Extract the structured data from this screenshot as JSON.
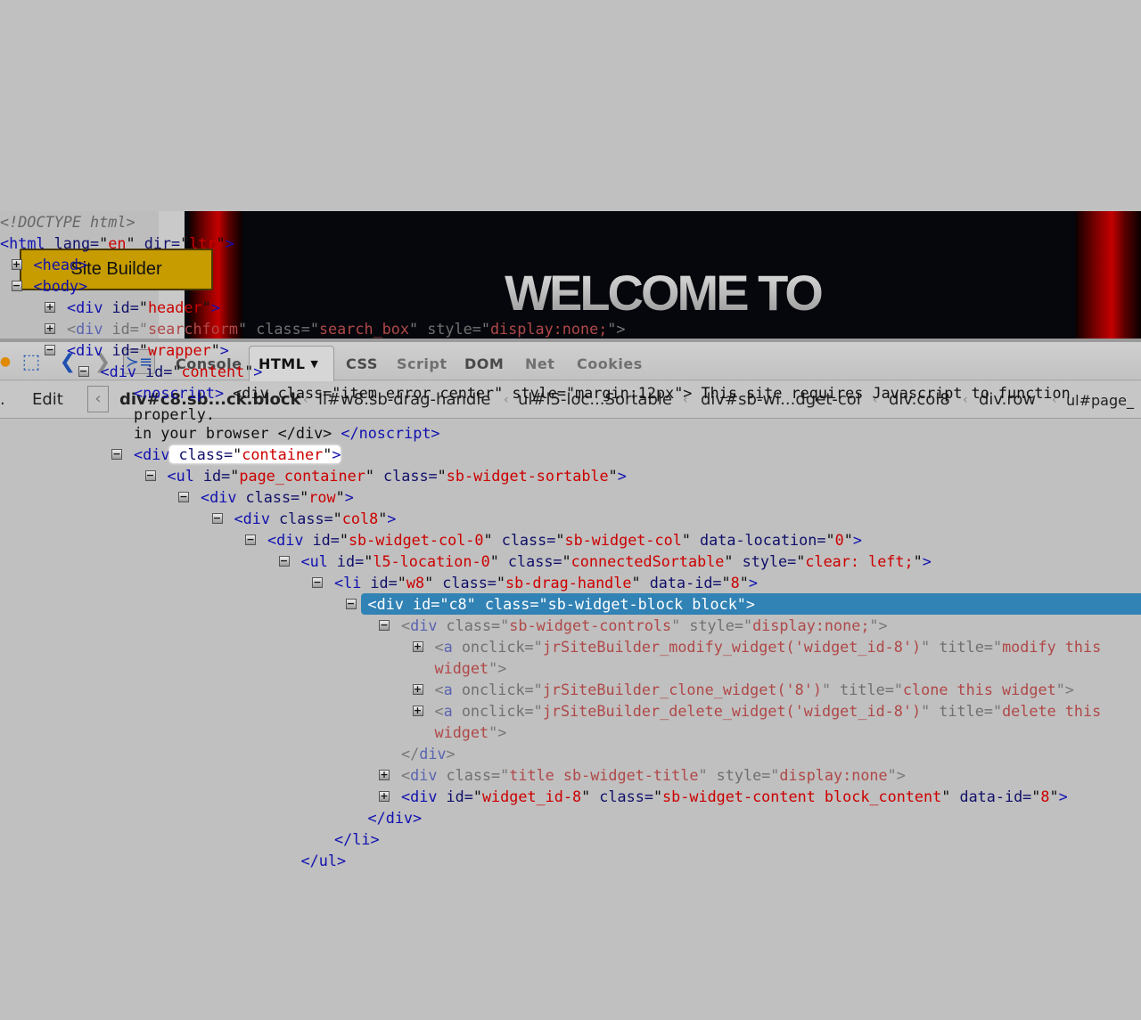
{
  "site": {
    "button": "Site Builder",
    "banner_text": "WELCOME TO"
  },
  "toolbar": {
    "tabs": [
      "Console",
      "HTML",
      "CSS",
      "Script",
      "DOM",
      "Net",
      "Cookies"
    ],
    "active_tab": "HTML"
  },
  "breadcrumbs": {
    "edit": "Edit",
    "items": [
      "div#c8.sb...ck.block",
      "li#w8.sb-drag-handle",
      "ul#l5-loc...Sortable",
      "div#sb-wi...dget-col",
      "div.col8",
      "div.row",
      "ul#page_"
    ]
  },
  "code": [
    {
      "lvl": 0,
      "t": "",
      "p": [
        [
          "cm",
          "<!DOCTYPE html>"
        ]
      ]
    },
    {
      "lvl": 0,
      "t": "",
      "p": [
        [
          "br",
          "<"
        ],
        [
          "tg",
          "html"
        ],
        [
          "an",
          " lang="
        ],
        [
          "tx",
          "\""
        ],
        [
          "av",
          "en"
        ],
        [
          "tx",
          "\""
        ],
        [
          "an",
          " dir="
        ],
        [
          "tx",
          "\""
        ],
        [
          "av",
          "ltr"
        ],
        [
          "tx",
          "\""
        ],
        [
          "br",
          ">"
        ]
      ]
    },
    {
      "lvl": 1,
      "t": "+",
      "p": [
        [
          "br",
          "<"
        ],
        [
          "tg",
          "head"
        ],
        [
          "br",
          ">"
        ]
      ]
    },
    {
      "lvl": 1,
      "t": "-",
      "p": [
        [
          "br",
          "<"
        ],
        [
          "tg",
          "body"
        ],
        [
          "br",
          ">"
        ]
      ]
    },
    {
      "lvl": 2,
      "t": "+",
      "p": [
        [
          "br",
          "<"
        ],
        [
          "tg",
          "div"
        ],
        [
          "an",
          " id="
        ],
        [
          "tx",
          "\""
        ],
        [
          "av",
          "header"
        ],
        [
          "tx",
          "\""
        ],
        [
          "br",
          ">"
        ]
      ]
    },
    {
      "lvl": 2,
      "t": "+",
      "f": 1,
      "p": [
        [
          "br",
          "<"
        ],
        [
          "tg",
          "div"
        ],
        [
          "an",
          " id="
        ],
        [
          "br",
          "\""
        ],
        [
          "av",
          "searchform"
        ],
        [
          "br",
          "\""
        ],
        [
          "an",
          " class="
        ],
        [
          "br",
          "\""
        ],
        [
          "av",
          "search_box"
        ],
        [
          "br",
          "\""
        ],
        [
          "an",
          " style="
        ],
        [
          "br",
          "\""
        ],
        [
          "av",
          "display:none;"
        ],
        [
          "br",
          "\">"
        ]
      ]
    },
    {
      "lvl": 2,
      "t": "-",
      "p": [
        [
          "br",
          "<"
        ],
        [
          "tg",
          "div"
        ],
        [
          "an",
          " id="
        ],
        [
          "tx",
          "\""
        ],
        [
          "av",
          "wrapper"
        ],
        [
          "tx",
          "\""
        ],
        [
          "br",
          ">"
        ]
      ]
    },
    {
      "lvl": 3,
      "t": "-",
      "p": [
        [
          "br",
          "<"
        ],
        [
          "tg",
          "div"
        ],
        [
          "an",
          " id="
        ],
        [
          "tx",
          "\""
        ],
        [
          "av",
          "content"
        ],
        [
          "tx",
          "\""
        ],
        [
          "br",
          ">"
        ]
      ]
    },
    {
      "lvl": 4,
      "t": "",
      "p": [
        [
          "br",
          "<"
        ],
        [
          "tg",
          "noscript"
        ],
        [
          "br",
          ">"
        ],
        [
          "tx",
          " <div class=\"item error center\" style=\"margin:12px\"> This site requires Javascript to function properly."
        ]
      ]
    },
    {
      "lvl": 4,
      "t": "",
      "w": 1,
      "p": [
        [
          "tx",
          "in your browser </div> "
        ],
        [
          "br",
          "</"
        ],
        [
          "tg",
          "noscript"
        ],
        [
          "br",
          ">"
        ]
      ]
    },
    {
      "lvl": 4,
      "t": "-",
      "h": 1,
      "p": [
        [
          "br",
          "<"
        ],
        [
          "tg",
          "div"
        ],
        [
          "an",
          " class="
        ],
        [
          "tx",
          "\""
        ],
        [
          "av",
          "container"
        ],
        [
          "tx",
          "\""
        ],
        [
          "br",
          ">"
        ]
      ]
    },
    {
      "lvl": 5,
      "t": "-",
      "p": [
        [
          "br",
          "<"
        ],
        [
          "tg",
          "ul"
        ],
        [
          "an",
          " id="
        ],
        [
          "tx",
          "\""
        ],
        [
          "av",
          "page_container"
        ],
        [
          "tx",
          "\""
        ],
        [
          "an",
          " class="
        ],
        [
          "tx",
          "\""
        ],
        [
          "av",
          "sb-widget-sortable"
        ],
        [
          "tx",
          "\""
        ],
        [
          "br",
          ">"
        ]
      ]
    },
    {
      "lvl": 6,
      "t": "-",
      "p": [
        [
          "br",
          "<"
        ],
        [
          "tg",
          "div"
        ],
        [
          "an",
          " class="
        ],
        [
          "tx",
          "\""
        ],
        [
          "av",
          "row"
        ],
        [
          "tx",
          "\""
        ],
        [
          "br",
          ">"
        ]
      ]
    },
    {
      "lvl": 7,
      "t": "-",
      "p": [
        [
          "br",
          "<"
        ],
        [
          "tg",
          "div"
        ],
        [
          "an",
          " class="
        ],
        [
          "tx",
          "\""
        ],
        [
          "av",
          "col8"
        ],
        [
          "tx",
          "\""
        ],
        [
          "br",
          ">"
        ]
      ]
    },
    {
      "lvl": 8,
      "t": "-",
      "p": [
        [
          "br",
          "<"
        ],
        [
          "tg",
          "div"
        ],
        [
          "an",
          " id="
        ],
        [
          "tx",
          "\""
        ],
        [
          "av",
          "sb-widget-col-0"
        ],
        [
          "tx",
          "\""
        ],
        [
          "an",
          " class="
        ],
        [
          "tx",
          "\""
        ],
        [
          "av",
          "sb-widget-col"
        ],
        [
          "tx",
          "\""
        ],
        [
          "an",
          " data-location="
        ],
        [
          "tx",
          "\""
        ],
        [
          "av",
          "0"
        ],
        [
          "tx",
          "\""
        ],
        [
          "br",
          ">"
        ]
      ]
    },
    {
      "lvl": 9,
      "t": "-",
      "p": [
        [
          "br",
          "<"
        ],
        [
          "tg",
          "ul"
        ],
        [
          "an",
          " id="
        ],
        [
          "tx",
          "\""
        ],
        [
          "av",
          "l5-location-0"
        ],
        [
          "tx",
          "\""
        ],
        [
          "an",
          " class="
        ],
        [
          "tx",
          "\""
        ],
        [
          "av",
          "connectedSortable"
        ],
        [
          "tx",
          "\""
        ],
        [
          "an",
          " style="
        ],
        [
          "tx",
          "\""
        ],
        [
          "av",
          "clear: left;"
        ],
        [
          "tx",
          "\""
        ],
        [
          "br",
          ">"
        ]
      ]
    },
    {
      "lvl": 10,
      "t": "-",
      "p": [
        [
          "br",
          "<"
        ],
        [
          "tg",
          "li"
        ],
        [
          "an",
          " id="
        ],
        [
          "tx",
          "\""
        ],
        [
          "av",
          "w8"
        ],
        [
          "tx",
          "\""
        ],
        [
          "an",
          " class="
        ],
        [
          "tx",
          "\""
        ],
        [
          "av",
          "sb-drag-handle"
        ],
        [
          "tx",
          "\""
        ],
        [
          "an",
          " data-id="
        ],
        [
          "tx",
          "\""
        ],
        [
          "av",
          "8"
        ],
        [
          "tx",
          "\""
        ],
        [
          "br",
          ">"
        ]
      ]
    },
    {
      "lvl": 11,
      "t": "-",
      "s": 1,
      "p": [
        [
          "br",
          "<"
        ],
        [
          "tg",
          "div"
        ],
        [
          "an",
          " id="
        ],
        [
          "tx",
          "\""
        ],
        [
          "av",
          "c8"
        ],
        [
          "tx",
          "\""
        ],
        [
          "an",
          " class="
        ],
        [
          "tx",
          "\""
        ],
        [
          "av",
          "sb-widget-block block"
        ],
        [
          "tx",
          "\""
        ],
        [
          "br",
          ">"
        ]
      ]
    },
    {
      "lvl": 12,
      "t": "-",
      "f": 1,
      "p": [
        [
          "br",
          "<"
        ],
        [
          "tg",
          "div"
        ],
        [
          "an",
          " class="
        ],
        [
          "br",
          "\""
        ],
        [
          "av",
          "sb-widget-controls"
        ],
        [
          "br",
          "\""
        ],
        [
          "an",
          " style="
        ],
        [
          "br",
          "\""
        ],
        [
          "av",
          "display:none;"
        ],
        [
          "br",
          "\">"
        ]
      ]
    },
    {
      "lvl": 13,
      "t": "+",
      "f": 1,
      "p": [
        [
          "br",
          "<"
        ],
        [
          "tg",
          "a"
        ],
        [
          "an",
          " onclick="
        ],
        [
          "br",
          "\""
        ],
        [
          "av",
          "jrSiteBuilder_modify_widget('widget_id-8')"
        ],
        [
          "br",
          "\""
        ],
        [
          "an",
          " title="
        ],
        [
          "br",
          "\""
        ],
        [
          "av",
          "modify this widget"
        ],
        [
          "br",
          "\">"
        ]
      ]
    },
    {
      "lvl": 13,
      "t": "+",
      "f": 1,
      "p": [
        [
          "br",
          "<"
        ],
        [
          "tg",
          "a"
        ],
        [
          "an",
          " onclick="
        ],
        [
          "br",
          "\""
        ],
        [
          "av",
          "jrSiteBuilder_clone_widget('8')"
        ],
        [
          "br",
          "\""
        ],
        [
          "an",
          " title="
        ],
        [
          "br",
          "\""
        ],
        [
          "av",
          "clone this widget"
        ],
        [
          "br",
          "\">"
        ]
      ]
    },
    {
      "lvl": 13,
      "t": "+",
      "f": 1,
      "p": [
        [
          "br",
          "<"
        ],
        [
          "tg",
          "a"
        ],
        [
          "an",
          " onclick="
        ],
        [
          "br",
          "\""
        ],
        [
          "av",
          "jrSiteBuilder_delete_widget('widget_id-8')"
        ],
        [
          "br",
          "\""
        ],
        [
          "an",
          " title="
        ],
        [
          "br",
          "\""
        ],
        [
          "av",
          "delete this widget"
        ],
        [
          "br",
          "\">"
        ]
      ]
    },
    {
      "lvl": 12,
      "t": "",
      "f": 1,
      "p": [
        [
          "br",
          "</"
        ],
        [
          "tg",
          "div"
        ],
        [
          "br",
          ">"
        ]
      ]
    },
    {
      "lvl": 12,
      "t": "+",
      "f": 1,
      "p": [
        [
          "br",
          "<"
        ],
        [
          "tg",
          "div"
        ],
        [
          "an",
          " class="
        ],
        [
          "br",
          "\""
        ],
        [
          "av",
          "title sb-widget-title"
        ],
        [
          "br",
          "\""
        ],
        [
          "an",
          " style="
        ],
        [
          "br",
          "\""
        ],
        [
          "av",
          "display:none"
        ],
        [
          "br",
          "\">"
        ]
      ]
    },
    {
      "lvl": 12,
      "t": "+",
      "p": [
        [
          "br",
          "<"
        ],
        [
          "tg",
          "div"
        ],
        [
          "an",
          " id="
        ],
        [
          "tx",
          "\""
        ],
        [
          "av",
          "widget_id-8"
        ],
        [
          "tx",
          "\""
        ],
        [
          "an",
          " class="
        ],
        [
          "tx",
          "\""
        ],
        [
          "av",
          "sb-widget-content block_content"
        ],
        [
          "tx",
          "\""
        ],
        [
          "an",
          " data-id="
        ],
        [
          "tx",
          "\""
        ],
        [
          "av",
          "8"
        ],
        [
          "tx",
          "\""
        ],
        [
          "br",
          ">"
        ]
      ]
    },
    {
      "lvl": 11,
      "t": "",
      "p": [
        [
          "br",
          "</"
        ],
        [
          "tg",
          "div"
        ],
        [
          "br",
          ">"
        ]
      ]
    },
    {
      "lvl": 10,
      "t": "",
      "p": [
        [
          "br",
          "</"
        ],
        [
          "tg",
          "li"
        ],
        [
          "br",
          ">"
        ]
      ]
    },
    {
      "lvl": 9,
      "t": "",
      "p": [
        [
          "br",
          "</"
        ],
        [
          "tg",
          "ul"
        ],
        [
          "br",
          ">"
        ]
      ]
    }
  ]
}
